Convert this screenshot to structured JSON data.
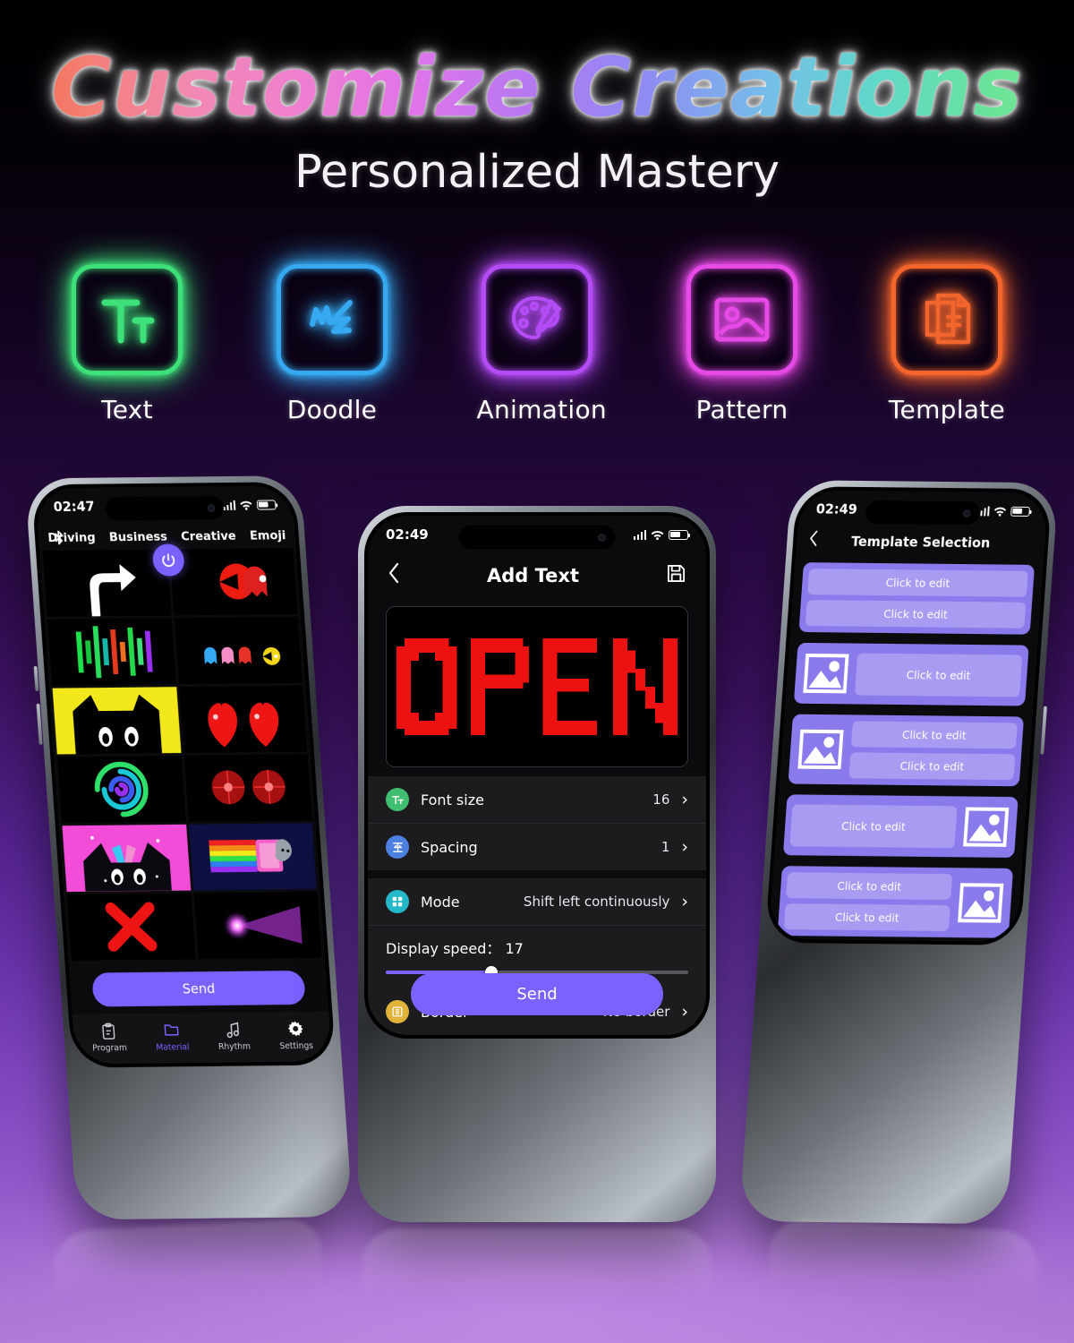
{
  "header": {
    "title": "Customize Creations",
    "subtitle": "Personalized Mastery"
  },
  "accent_color": "#7b61ff",
  "feature_icons": [
    {
      "label": "Text",
      "icon": "text-icon",
      "color": "#3ee07a"
    },
    {
      "label": "Doodle",
      "icon": "doodle-icon",
      "color": "#37a9f0"
    },
    {
      "label": "Animation",
      "icon": "palette-icon",
      "color": "#b44cf5"
    },
    {
      "label": "Pattern",
      "icon": "image-icon",
      "color": "#e64ae6"
    },
    {
      "label": "Template",
      "icon": "documents-icon",
      "color": "#f2652d"
    }
  ],
  "phone_left": {
    "status": {
      "time": "02:47",
      "bluetooth_icon": "bluetooth-icon",
      "signal_icon": "signal-bars-icon",
      "wifi_icon": "wifi-icon",
      "battery_icon": "battery-icon"
    },
    "power_button": "power-icon",
    "tabs": [
      "Driving",
      "Business",
      "Creative",
      "Emoji"
    ],
    "gallery": [
      "white-hand-thumb",
      "red-pacman-ghost-thumb",
      "audio-bars-thumb",
      "pacman-ghosts-thumb",
      "yellow-cat-thumb",
      "red-hearts-thumb",
      "neon-spiral-thumb",
      "red-flowers-thumb",
      "pink-cat-thumb",
      "nyan-cat-thumb",
      "red-x-thumb",
      "purple-beam-thumb"
    ],
    "send_label": "Send",
    "nav": [
      {
        "label": "Program",
        "icon": "clipboard-icon",
        "active": false
      },
      {
        "label": "Material",
        "icon": "folder-icon",
        "active": true
      },
      {
        "label": "Rhythm",
        "icon": "music-note-icon",
        "active": false
      },
      {
        "label": "Settings",
        "icon": "gear-icon",
        "active": false
      }
    ]
  },
  "phone_mid": {
    "status": {
      "time": "02:49",
      "signal_icon": "signal-bars-icon",
      "wifi_icon": "wifi-icon",
      "battery_icon": "battery-icon"
    },
    "back_icon": "chevron-left-icon",
    "title": "Add Text",
    "save_icon": "save-floppy-icon",
    "led_text": "OPEN",
    "led_color": "#ee1111",
    "settings": [
      {
        "label": "Font size",
        "value": "16",
        "icon": "font-size-icon",
        "icon_color": "#3fbf6f",
        "chevron": "chevron-right-icon"
      },
      {
        "label": "Spacing",
        "value": "1",
        "icon": "spacing-icon",
        "icon_color": "#4b7fe0",
        "chevron": "chevron-right-icon"
      },
      {
        "label": "Mode",
        "value": "Shift left continuously",
        "icon": "mode-grid-icon",
        "icon_color": "#24b9c9",
        "chevron": "chevron-right-icon"
      },
      {
        "label": "Border",
        "value": "No border",
        "icon": "border-icon",
        "icon_color": "#e2b33b",
        "chevron": "chevron-right-icon"
      }
    ],
    "speed": {
      "label": "Display speed：",
      "value": "17",
      "percent": 35
    },
    "send_label": "Send"
  },
  "phone_right": {
    "status": {
      "time": "02:49",
      "signal_icon": "signal-bars-icon",
      "wifi_icon": "wifi-icon",
      "battery_icon": "battery-icon"
    },
    "back_icon": "chevron-left-icon",
    "title": "Template Selection",
    "slot_label": "Click to edit",
    "templates": [
      {
        "layout": "text-text",
        "lines": [
          "Click to edit",
          "Click to edit"
        ]
      },
      {
        "layout": "image-text",
        "lines": [
          "Click to edit"
        ]
      },
      {
        "layout": "image-text-text",
        "lines": [
          "Click to edit",
          "Click to edit"
        ]
      },
      {
        "layout": "text-image",
        "lines": [
          "Click to edit"
        ]
      },
      {
        "layout": "text-text-image",
        "lines": [
          "Click to edit",
          "Click to edit"
        ]
      }
    ]
  }
}
